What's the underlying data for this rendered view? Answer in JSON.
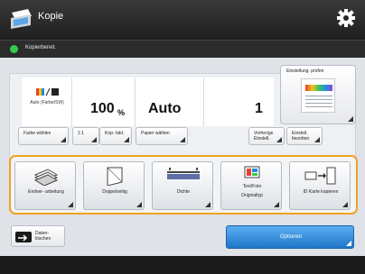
{
  "header": {
    "title": "Kopie",
    "app_icon": "copier-app-icon",
    "settings_icon": "gear-icon"
  },
  "status": {
    "text": "Kopierbereit.",
    "color": "#39c94a"
  },
  "summary": {
    "color_mode": {
      "icon": "color-bw-icon",
      "label": "Auto (Farbe/SW)"
    },
    "zoom": {
      "value": "100",
      "unit": "%"
    },
    "paper": {
      "value": "Auto"
    },
    "copies": {
      "value": "1"
    }
  },
  "preview": {
    "label": "Einstellung. prüfen"
  },
  "buttons": {
    "color_select": "Farbe wählen",
    "zoom_1to1": "1:1",
    "copy_ratio": "Kop- fakt.",
    "paper_select": "Papier wählen",
    "previous_settings": "Vorherige Einstell.",
    "favorites": "Einstell. favoriten"
  },
  "functions": [
    {
      "icon": "finisher-icon",
      "label": "Endver- arbeitung"
    },
    {
      "icon": "two-sided-icon",
      "label": "Doppelseitig"
    },
    {
      "icon": "density-icon",
      "label": "Dichte"
    },
    {
      "icon": "original-type-icon",
      "label": "Originaltyp",
      "sub": "Text/Foto"
    },
    {
      "icon": "id-card-icon",
      "label": "ID Karte kopieren"
    }
  ],
  "bottom": {
    "reset_label": "Daten-\nlöschen",
    "options_label": "Optionen"
  },
  "accent_color": "#f0a221",
  "options_color": "#1f76c9"
}
